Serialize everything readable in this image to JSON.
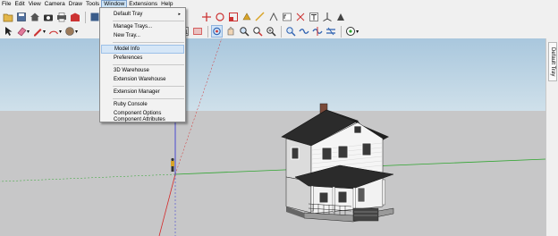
{
  "menubar": {
    "items": [
      "File",
      "Edit",
      "View",
      "Camera",
      "Draw",
      "Tools",
      "Window",
      "Extensions",
      "Help"
    ],
    "active": "Window"
  },
  "window_menu": {
    "items": [
      {
        "label": "Default Tray",
        "submenu": true
      },
      {
        "label": "Manage Trays..."
      },
      {
        "label": "New Tray..."
      },
      {
        "label": "Model Info",
        "highlighted": true
      },
      {
        "label": "Preferences"
      },
      {
        "label": "3D Warehouse"
      },
      {
        "label": "Extension Warehouse"
      },
      {
        "label": "Extension Manager"
      },
      {
        "label": "Ruby Console"
      },
      {
        "label": "Component Options"
      },
      {
        "label": "Component Attributes"
      }
    ],
    "submenu_arrow": "▸"
  },
  "toolbar1": {
    "icons": [
      "open-icon",
      "save-icon",
      "home-icon",
      "camera-icon",
      "print-icon",
      "warehouse-icon",
      "extensions-icon",
      "move-icon",
      "rotate-icon",
      "scale-icon",
      "pushpull-icon",
      "followme-icon",
      "offset-icon",
      "protractor-icon",
      "tape-icon",
      "text-icon",
      "axes-icon",
      "paint-icon"
    ]
  },
  "toolbar2": {
    "icons": [
      "select-icon",
      "eraser-icon",
      "pencil-icon",
      "arc-icon",
      "shapes-icon",
      "text3d-icon",
      "section-icon",
      "zoom-extents-icon",
      "previous-view-icon",
      "orbit-icon",
      "pan-icon",
      "zoom-icon",
      "zoom-window-icon",
      "iso-view-icon",
      "top-view-icon",
      "front-view-icon",
      "side-view-icon",
      "xray-icon",
      "style-icon"
    ]
  },
  "tray": {
    "label": "Default Tray"
  },
  "colors": {
    "sky_top": "#a9c7dd",
    "ground": "#c7c7c8",
    "axis_red": "#d42a2a",
    "axis_green": "#2fa52f",
    "axis_blue": "#2a2ad4",
    "menu_highlight": "#d5e6f7"
  }
}
